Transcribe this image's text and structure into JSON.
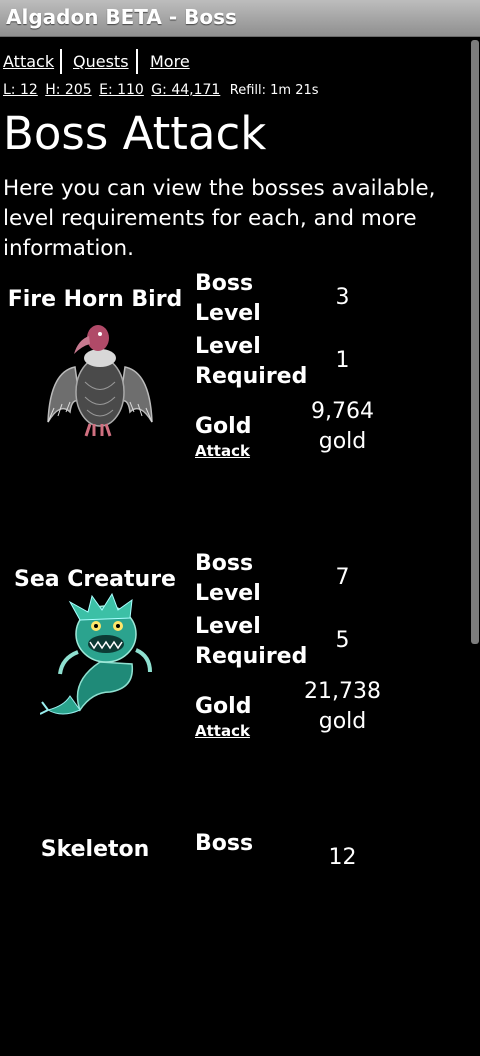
{
  "window": {
    "title": "Algadon BETA - Boss"
  },
  "nav": {
    "items": [
      "Attack",
      "Quests",
      "More"
    ]
  },
  "stats": {
    "level": "L: 12",
    "health": "H: 205",
    "energy": "E: 110",
    "gold": "G: 44,171",
    "refill": "Refill: 1m 21s"
  },
  "page": {
    "title": "Boss Attack",
    "intro": "Here you can view the bosses available, level requirements for each, and more information."
  },
  "labels": {
    "boss_level_1": "Boss",
    "boss_level_2": "Level",
    "level_req_1": "Level",
    "level_req_2": "Required",
    "gold": "Gold",
    "attack": "Attack"
  },
  "bosses": [
    {
      "name": "Fire Horn Bird",
      "boss_level": "3",
      "level_required": "1",
      "gold_amount": "9,764",
      "gold_unit": "gold",
      "image": "vulture-icon"
    },
    {
      "name": "Sea Creature",
      "boss_level": "7",
      "level_required": "5",
      "gold_amount": "21,738",
      "gold_unit": "gold",
      "image": "sea-monster-icon"
    },
    {
      "name": "Skeleton",
      "boss_level": "12",
      "image": "skeleton-icon"
    }
  ]
}
